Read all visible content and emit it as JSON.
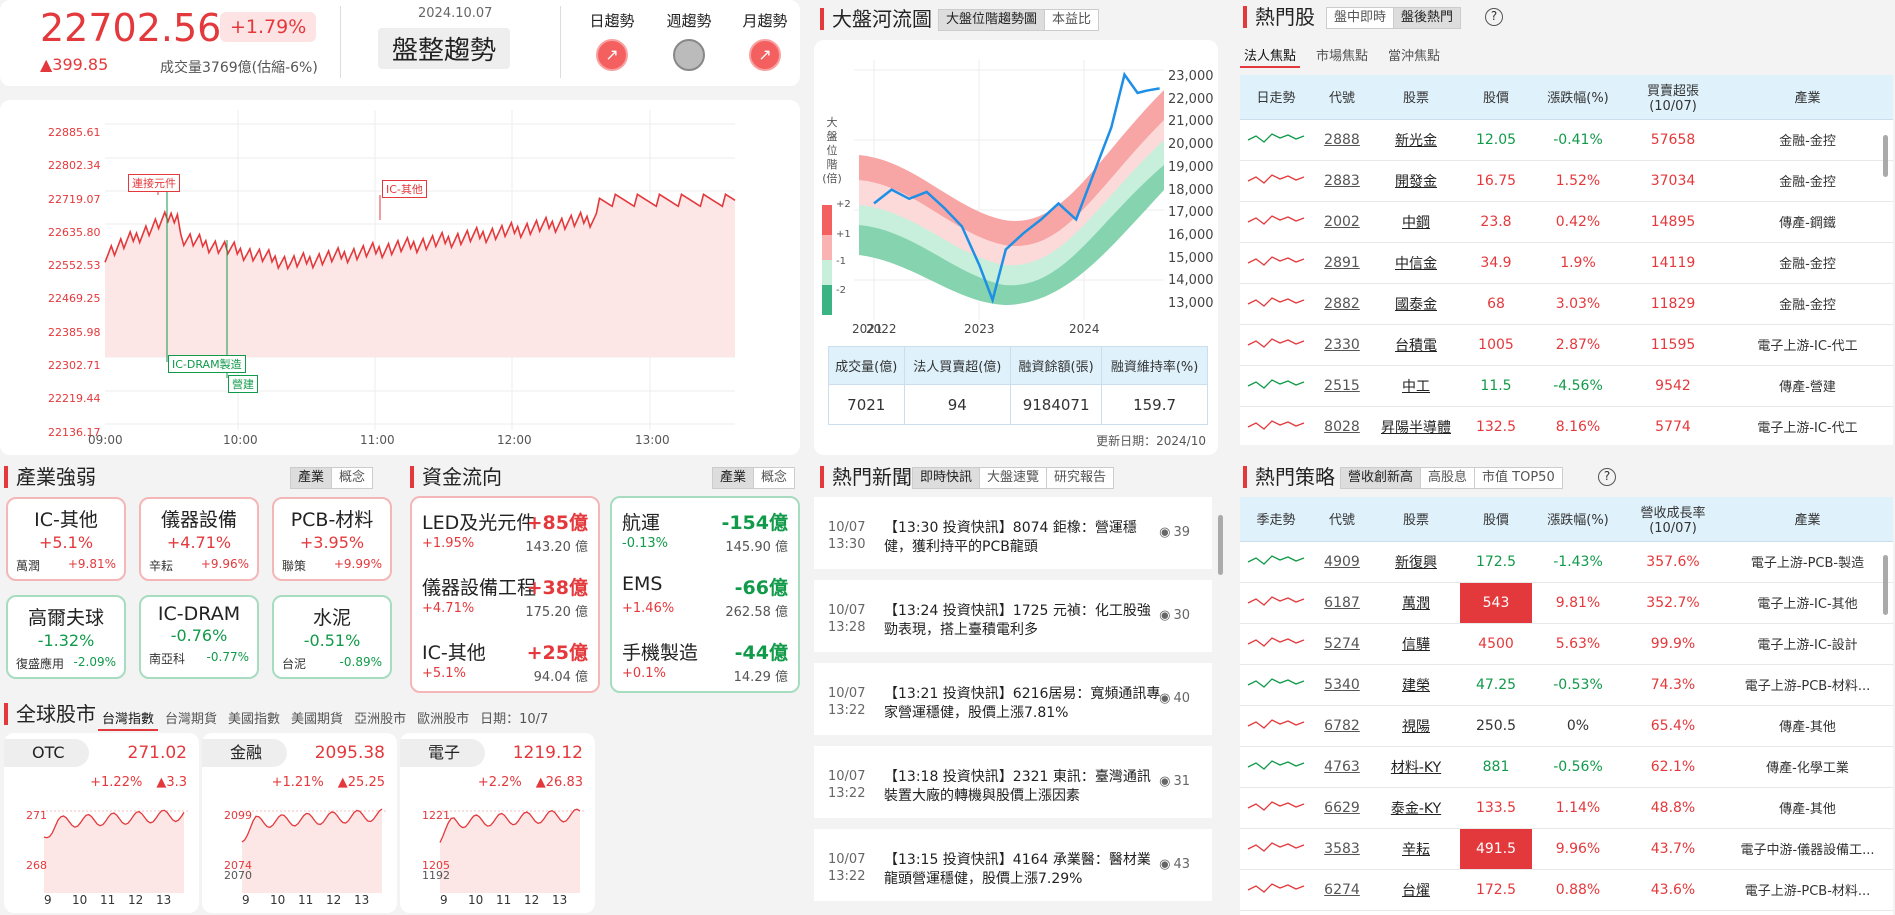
{
  "index": {
    "value": "22702.56",
    "pct": "+1.79%",
    "chg": "▲399.85",
    "volume": "成交量3769億(估縮-6%)",
    "date": "2024.10.07",
    "trend": "盤整趨勢",
    "trends": [
      {
        "label": "日趨勢",
        "state": "up"
      },
      {
        "label": "週趨勢",
        "state": "flat"
      },
      {
        "label": "月趨勢",
        "state": "up"
      }
    ]
  },
  "intraday": {
    "yticks": [
      "22885.61",
      "22802.34",
      "22719.07",
      "22635.80",
      "22552.53",
      "22469.25",
      "22385.98",
      "22302.71",
      "22219.44",
      "22136.17"
    ],
    "xticks": [
      "09:00",
      "10:00",
      "11:00",
      "12:00",
      "13:00"
    ],
    "tags": [
      "連接元件",
      "IC-其他",
      "IC-DRAM製造",
      "營建"
    ]
  },
  "river": {
    "title": "大盤河流圖",
    "tabs": [
      "大盤位階趨勢圖",
      "本益比"
    ],
    "side_label": [
      "大",
      "盤",
      "位",
      "階",
      "(倍)"
    ],
    "bands": [
      "+2",
      "+1",
      "-1",
      "-2"
    ],
    "yticks": [
      "23,000",
      "22,000",
      "21,000",
      "20,000",
      "19,000",
      "18,000",
      "17,000",
      "16,000",
      "15,000",
      "14,000",
      "13,000"
    ],
    "xticks": [
      "2021",
      "2022",
      "2023",
      "2024"
    ],
    "table": {
      "headers": [
        "成交量(億)",
        "法人買賣超(億)",
        "融資餘額(張)",
        "融資維持率(%)"
      ],
      "values": [
        "7021",
        "94",
        "9184071",
        "159.7"
      ]
    },
    "update": "更新日期：2024/10"
  },
  "chart_data": {
    "type": "line",
    "series": [
      {
        "x": [
          2021.5,
          2021.7,
          2021.9,
          2022.1,
          2022.3,
          2022.5,
          2022.7,
          2022.85,
          2023.0,
          2023.2,
          2023.4,
          2023.6,
          2023.8,
          2024.0,
          2024.2,
          2024.35,
          2024.5,
          2024.6,
          2024.75
        ],
        "values": [
          17200,
          17800,
          17400,
          17700,
          17000,
          16200,
          14500,
          13000,
          15200,
          15900,
          16500,
          17200,
          16500,
          18500,
          20500,
          22800,
          22000,
          22100,
          22200
        ]
      }
    ],
    "ylim": [
      12500,
      23500
    ],
    "yticks": [
      "23,000",
      "13,000"
    ],
    "xticks": [
      "2021",
      "2022",
      "2023",
      "2024"
    ]
  },
  "hot": {
    "title": "熱門股",
    "tabs": [
      "盤中即時",
      "盤後熱門"
    ],
    "subtabs": [
      "法人焦點",
      "市場焦點",
      "當沖焦點"
    ],
    "headers": [
      "日走勢",
      "代號",
      "股票",
      "股價",
      "漲跌幅(%)",
      "買賣超張\n(10/07)",
      "產業"
    ],
    "rows": [
      [
        "2888",
        "新光金",
        "12.05",
        "-0.41%",
        "57658",
        "金融-金控"
      ],
      [
        "2883",
        "開發金",
        "16.75",
        "1.52%",
        "37034",
        "金融-金控"
      ],
      [
        "2002",
        "中鋼",
        "23.8",
        "0.42%",
        "14895",
        "傳產-鋼鐵"
      ],
      [
        "2891",
        "中信金",
        "34.9",
        "1.9%",
        "14119",
        "金融-金控"
      ],
      [
        "2882",
        "國泰金",
        "68",
        "3.03%",
        "11829",
        "金融-金控"
      ],
      [
        "2330",
        "台積電",
        "1005",
        "2.87%",
        "11595",
        "電子上游-IC-代工"
      ],
      [
        "2515",
        "中工",
        "11.5",
        "-4.56%",
        "9542",
        "傳產-營建"
      ],
      [
        "8028",
        "昇陽半導體",
        "132.5",
        "8.16%",
        "5774",
        "電子上游-IC-代工"
      ]
    ]
  },
  "strategy": {
    "title": "熱門策略",
    "tabs": [
      "營收創新高",
      "高股息",
      "市值 TOP50"
    ],
    "headers": [
      "季走勢",
      "代號",
      "股票",
      "股價",
      "漲跌幅(%)",
      "營收成長率\n(10/07)",
      "產業"
    ],
    "rows": [
      [
        "4909",
        "新復興",
        "172.5",
        "-1.43%",
        "357.6%",
        "電子上游-PCB-製造"
      ],
      [
        "6187",
        "萬潤",
        "543",
        "9.81%",
        "352.7%",
        "電子上游-IC-其他"
      ],
      [
        "5274",
        "信驊",
        "4500",
        "5.63%",
        "99.9%",
        "電子上游-IC-設計"
      ],
      [
        "5340",
        "建榮",
        "47.25",
        "-0.53%",
        "74.3%",
        "電子上游-PCB-材料..."
      ],
      [
        "6782",
        "視陽",
        "250.5",
        "0%",
        "65.4%",
        "傳產-其他"
      ],
      [
        "4763",
        "材料-KY",
        "881",
        "-0.56%",
        "62.1%",
        "傳產-化學工業"
      ],
      [
        "6629",
        "泰金-KY",
        "133.5",
        "1.14%",
        "48.8%",
        "傳產-其他"
      ],
      [
        "3583",
        "辛耘",
        "491.5",
        "9.96%",
        "43.7%",
        "電子中游-儀器設備工..."
      ],
      [
        "6274",
        "台燿",
        "172.5",
        "0.88%",
        "43.6%",
        "電子上游-PCB-材料..."
      ]
    ]
  },
  "industry": {
    "title": "產業強弱",
    "tabs": [
      "產業",
      "概念"
    ],
    "cards": [
      {
        "name": "IC-其他",
        "pct": "+5.1%",
        "sub": "萬潤",
        "subpct": "+9.81%",
        "dir": "up"
      },
      {
        "name": "儀器設備",
        "pct": "+4.71%",
        "sub": "辛耘",
        "subpct": "+9.96%",
        "dir": "up"
      },
      {
        "name": "PCB-材料",
        "pct": "+3.95%",
        "sub": "聯策",
        "subpct": "+9.99%",
        "dir": "up"
      },
      {
        "name": "高爾夫球",
        "pct": "-1.32%",
        "sub": "復盛應用",
        "subpct": "-2.09%",
        "dir": "dn"
      },
      {
        "name": "IC-DRAM",
        "pct": "-0.76%",
        "sub": "南亞科",
        "subpct": "-0.77%",
        "dir": "dn"
      },
      {
        "name": "水泥",
        "pct": "-0.51%",
        "sub": "台泥",
        "subpct": "-0.89%",
        "dir": "dn"
      }
    ]
  },
  "flow": {
    "title": "資金流向",
    "tabs": [
      "產業",
      "概念"
    ],
    "up": [
      {
        "name": "LED及光元件",
        "val": "+85億",
        "pct": "+1.95%",
        "amt": "143.20 億"
      },
      {
        "name": "儀器設備工程",
        "val": "+38億",
        "pct": "+4.71%",
        "amt": "175.20 億"
      },
      {
        "name": "IC-其他",
        "val": "+25億",
        "pct": "+5.1%",
        "amt": "94.04 億"
      }
    ],
    "dn": [
      {
        "name": "航運",
        "val": "-154億",
        "pct": "-0.13%",
        "amt": "145.90 億"
      },
      {
        "name": "EMS",
        "val": "-66億",
        "pct": "+1.46%",
        "amt": "262.58 億"
      },
      {
        "name": "手機製造",
        "val": "-44億",
        "pct": "+0.1%",
        "amt": "14.29 億"
      }
    ]
  },
  "news": {
    "title": "熱門新聞",
    "tabs": [
      "即時快訊",
      "大盤速覽",
      "研究報告"
    ],
    "items": [
      {
        "date": "10/07",
        "time": "13:30",
        "head": "【13:30 投資快訊】8074 鉅橡：營運穩健，獲利持平的PCB龍頭",
        "count": "39"
      },
      {
        "date": "10/07",
        "time": "13:28",
        "head": "【13:24 投資快訊】1725 元禎：化工股強勁表現，搭上臺積電利多",
        "count": "30"
      },
      {
        "date": "10/07",
        "time": "13:22",
        "head": "【13:21 投資快訊】6216居易：寬頻通訊專家營運穩健，股價上漲7.81%",
        "count": "40"
      },
      {
        "date": "10/07",
        "time": "13:22",
        "head": "【13:18 投資快訊】2321 東訊：臺灣通訊裝置大廠的轉機與股價上漲因素",
        "count": "31"
      },
      {
        "date": "10/07",
        "time": "13:22",
        "head": "【13:15 投資快訊】4164 承業醫：醫材業龍頭營運穩健，股價上漲7.29%",
        "count": "43"
      }
    ]
  },
  "global": {
    "title": "全球股市",
    "tabs": [
      "台灣指數",
      "台灣期貨",
      "美國指數",
      "美國期貨",
      "亞洲股市",
      "歐洲股市"
    ],
    "date": "日期：10/7",
    "cards": [
      {
        "name": "OTC",
        "val": "271.02",
        "pct": "+1.22%",
        "chg": "▲3.3",
        "ytop": "271",
        "ybot": "268"
      },
      {
        "name": "金融",
        "val": "2095.38",
        "pct": "+1.21%",
        "chg": "▲25.25",
        "ytop": "2099",
        "ybot": "2074"
      },
      {
        "name": "電子",
        "val": "1219.12",
        "pct": "+2.2%",
        "chg": "▲26.83",
        "ytop": "1221",
        "ybot": "1205"
      }
    ],
    "extra_ticks": [
      "2070",
      "1192"
    ],
    "xticks": [
      "9",
      "10",
      "11",
      "12",
      "13"
    ]
  }
}
